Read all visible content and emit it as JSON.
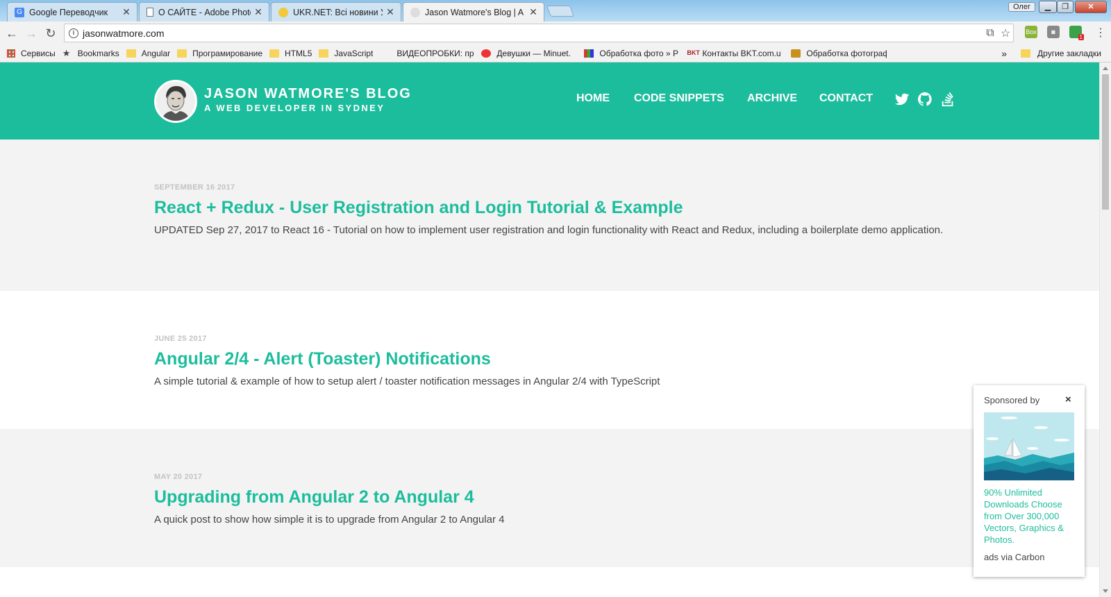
{
  "browser": {
    "tabs": [
      {
        "label": "Google Переводчик",
        "active": false,
        "favicon": "google-translate-icon"
      },
      {
        "label": "О САЙТЕ - Adobe Photo",
        "active": false,
        "favicon": "page-icon"
      },
      {
        "label": "UKR.NET: Всі новини Укр",
        "active": false,
        "favicon": "ukrnet-icon"
      },
      {
        "label": "Jason Watmore's Blog | A",
        "active": true,
        "favicon": "avatar-icon"
      }
    ],
    "close_glyph": "✕",
    "profile_name": "Олег",
    "address": "jasonwatmore.com",
    "bookmarks": [
      {
        "label": "Сервисы",
        "icon": "apps-grid-icon"
      },
      {
        "label": "Bookmarks",
        "icon": "star-icon"
      },
      {
        "label": "Angular",
        "icon": "folder-icon"
      },
      {
        "label": "Програмирование",
        "icon": "folder-icon"
      },
      {
        "label": "HTML5",
        "icon": "folder-icon"
      },
      {
        "label": "JavaScript",
        "icon": "folder-icon"
      },
      {
        "label": "ВИДЕОПРОБКИ: про",
        "icon": "none"
      },
      {
        "label": "Девушки — Minuet.",
        "icon": "minuet-icon"
      },
      {
        "label": "Обработка фото » P",
        "icon": "photo-icon"
      },
      {
        "label": "Контакты BKT.com.u",
        "icon": "bkt-icon"
      },
      {
        "label": "Обработка фотограф",
        "icon": "photo2-icon"
      }
    ],
    "more_bookmarks_glyph": "»",
    "other_bookmarks": "Другие закладки",
    "extension_badge": "1"
  },
  "site": {
    "title": "JASON WATMORE'S BLOG",
    "subtitle": "A WEB DEVELOPER IN SYDNEY",
    "nav": [
      {
        "label": "HOME"
      },
      {
        "label": "CODE SNIPPETS"
      },
      {
        "label": "ARCHIVE"
      },
      {
        "label": "CONTACT"
      }
    ],
    "social_icons": [
      "twitter-icon",
      "github-icon",
      "stackoverflow-icon"
    ],
    "accent_color": "#1cbd9c"
  },
  "posts": [
    {
      "date": "SEPTEMBER 16 2017",
      "title": "React + Redux - User Registration and Login Tutorial & Example",
      "summary": "UPDATED Sep 27, 2017 to React 16 - Tutorial on how to implement user registration and login functionality with React and Redux, including a boilerplate demo application."
    },
    {
      "date": "JUNE 25 2017",
      "title": "Angular 2/4 - Alert (Toaster) Notifications",
      "summary": "A simple tutorial & example of how to setup alert / toaster notification messages in Angular 2/4 with TypeScript"
    },
    {
      "date": "MAY 20 2017",
      "title": "Upgrading from Angular 2 to Angular 4",
      "summary": "A quick post to show how simple it is to upgrade from Angular 2 to Angular 4"
    }
  ],
  "ad": {
    "sponsored_label": "Sponsored by",
    "close_glyph": "×",
    "text": "90% Unlimited Downloads Choose from Over 300,000 Vectors, Graphics & Photos.",
    "via": "ads via Carbon"
  }
}
